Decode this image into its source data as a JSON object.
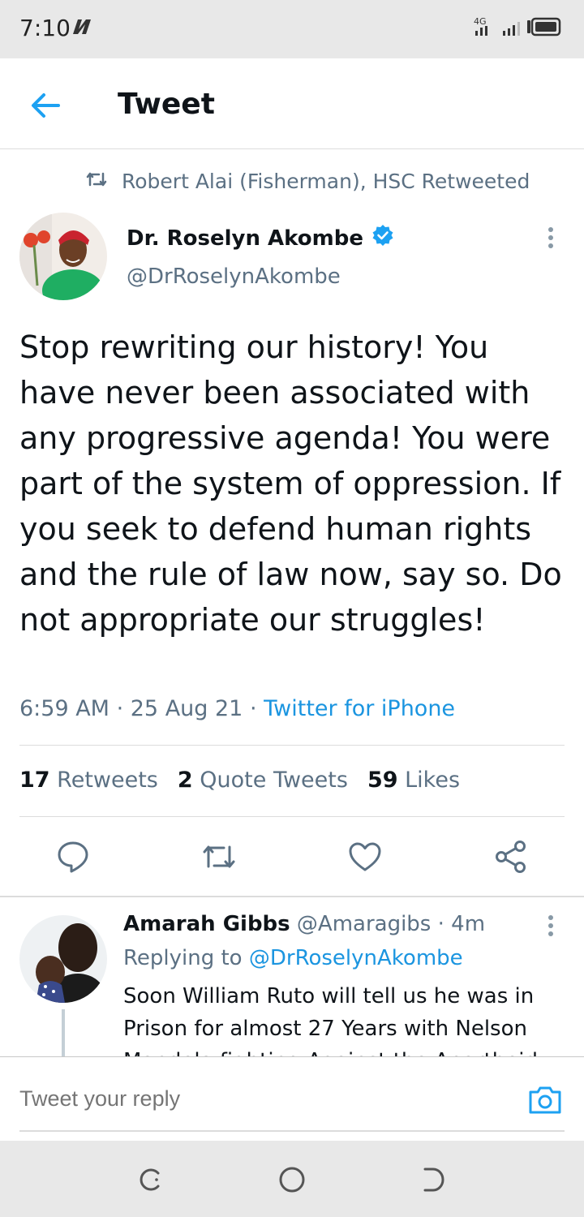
{
  "status_bar": {
    "time": "7:10",
    "network": "4G"
  },
  "header": {
    "title": "Tweet"
  },
  "retweet_context": "Robert Alai (Fisherman), HSC Retweeted",
  "tweet": {
    "author_name": "Dr. Roselyn Akombe",
    "author_handle": "@DrRoselynAkombe",
    "text": "Stop rewriting our history! You have never been associated with any progressive agenda! You were part of the system of oppression. If you seek to defend human rights and the rule of law now, say so. Do not appropriate our struggles!",
    "time": "6:59 AM",
    "date": "25 Aug 21",
    "source": "Twitter for iPhone",
    "retweets_count": "17",
    "retweets_label": "Retweets",
    "quotes_count": "2",
    "quotes_label": "Quote Tweets",
    "likes_count": "59",
    "likes_label": "Likes"
  },
  "reply": {
    "author_name": "Amarah Gibbs",
    "author_handle": "@Amaragibs",
    "age": "4m",
    "replying_prefix": "Replying to",
    "replying_to": "@DrRoselynAkombe",
    "text": "Soon William Ruto will tell us he was in Prison for almost 27 Years with Nelson Mandela fighting Against the Apartheid"
  },
  "composer": {
    "placeholder": "Tweet your reply"
  },
  "colors": {
    "accent": "#1da1f2",
    "link": "#1b95e0",
    "secondary_text": "#5b7083",
    "verified": "#1da1f2"
  },
  "icons": [
    "back-arrow-icon",
    "retweet-icon",
    "verified-badge-icon",
    "more-options-icon",
    "reply-icon",
    "retweet-icon",
    "like-icon",
    "share-icon",
    "camera-icon",
    "recent-apps-icon",
    "home-icon",
    "back-icon"
  ]
}
